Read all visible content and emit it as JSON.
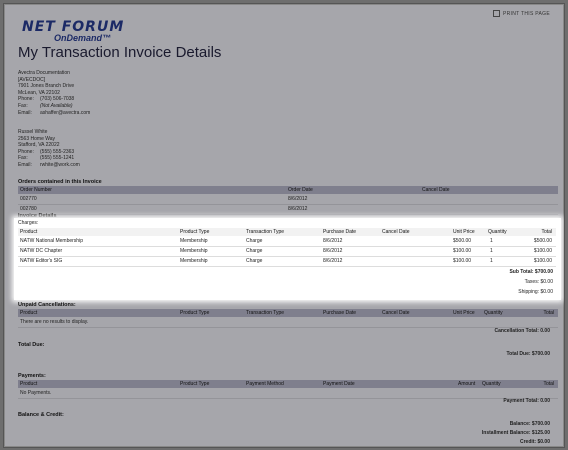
{
  "logo": {
    "line1": "NET FORUM",
    "line2": "OnDemand™"
  },
  "print_label": "PRINT THIS PAGE",
  "page_title": "My Transaction Invoice Details",
  "org": {
    "name": "Avectra Documentation",
    "code": "[AVECDOC]",
    "street": "7901 Jones Branch Drive",
    "city": "McLean, VA 22102",
    "phone_label": "Phone:",
    "phone": "(703) 506-7038",
    "fax_label": "Fax:",
    "fax": "(Not Available)",
    "email_label": "Email:",
    "email": "ashaffer@avectra.com"
  },
  "person": {
    "name": "Russel White",
    "street": "2563 Home Way",
    "city": "Stafford, VA 22022",
    "phone_label": "Phone:",
    "phone": "(555) 555-2363",
    "fax_label": "Fax:",
    "fax": "(555) 555-1241",
    "email_label": "Email:",
    "email": "rwhite@work.com"
  },
  "orders": {
    "title": "Orders contained in this Invoice",
    "headers": [
      "Order Number",
      "Order Date",
      "Cancel Date"
    ],
    "rows": [
      [
        "002770",
        "8/6/2012",
        ""
      ],
      [
        "002780",
        "8/6/2012",
        ""
      ]
    ]
  },
  "invoice": {
    "title": "Invoice Details",
    "charges_label": "Charges:",
    "headers": [
      "Product",
      "Product Type",
      "Transaction Type",
      "Purchase Date",
      "Cancel Date",
      "Unit Price",
      "Quantity",
      "Total"
    ],
    "rows": [
      [
        "NATW National Membership",
        "Membership",
        "Charge",
        "8/6/2012",
        "",
        "$500.00",
        "1",
        "$500.00"
      ],
      [
        "NATW DC Chapter",
        "Membership",
        "Charge",
        "8/6/2012",
        "",
        "$100.00",
        "1",
        "$100.00"
      ],
      [
        "NATW Editor's SIG",
        "Membership",
        "Charge",
        "8/6/2012",
        "",
        "$100.00",
        "1",
        "$100.00"
      ]
    ],
    "subtotal": "Sub Total: $700.00",
    "taxes": "Taxes: $0.00",
    "shipping": "Shipping: $0.00"
  },
  "cancellations": {
    "title": "Unpaid Cancellations:",
    "headers": [
      "Product",
      "Product Type",
      "Transaction Type",
      "Purchase Date",
      "Cancel Date",
      "Unit Price",
      "Quantity",
      "Total"
    ],
    "empty": "There are no results to display.",
    "total": "Cancellation Total: 0.00"
  },
  "due": {
    "title": "Total Due:",
    "total": "Total Due: $700.00"
  },
  "payments": {
    "title": "Payments:",
    "headers": [
      "Product",
      "Product Type",
      "Payment Method",
      "Payment Date",
      "Amount",
      "Quantity",
      "Total"
    ],
    "empty": "No Payments.",
    "total": "Payment Total: 0.00"
  },
  "balance": {
    "title": "Balance & Credit:",
    "balance": "Balance: $700.00",
    "installment": "Installment Balance: $125.00",
    "credit": "Credit: $0.00"
  }
}
